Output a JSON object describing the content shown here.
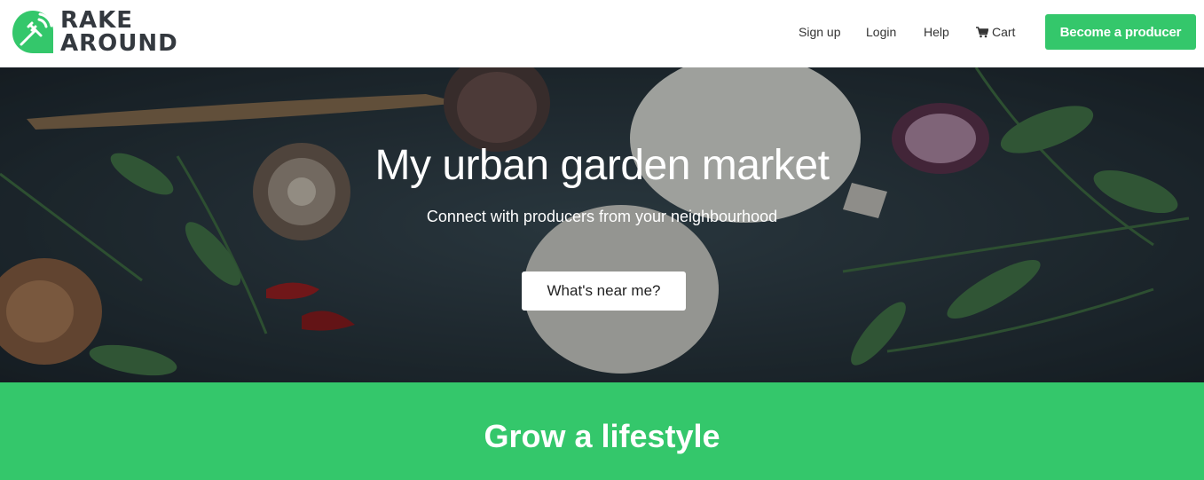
{
  "brand": {
    "line1": "RAKE",
    "line2": "AROUND",
    "color": "#34c76b"
  },
  "nav": {
    "signup": "Sign up",
    "login": "Login",
    "help": "Help",
    "cart": "Cart",
    "cart_icon": "cart-icon",
    "producer_button": "Become a producer"
  },
  "hero": {
    "title": "My urban garden market",
    "subtitle": "Connect with producers from your neighbourhood",
    "cta": "What's near me?"
  },
  "band": {
    "title": "Grow a lifestyle",
    "color": "#34c76b"
  }
}
